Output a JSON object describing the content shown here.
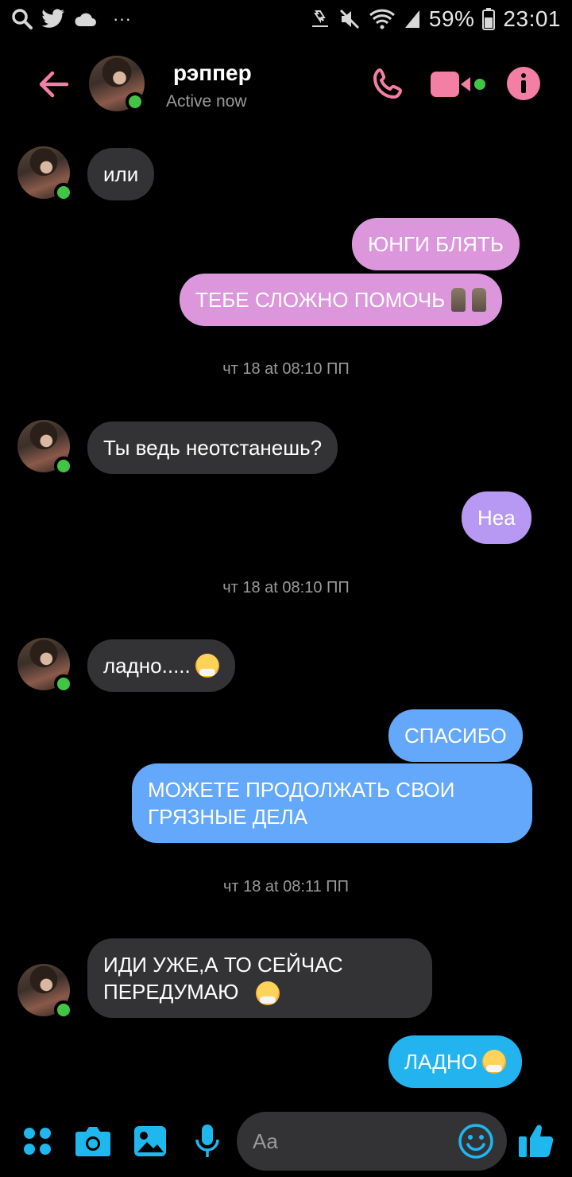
{
  "status_bar": {
    "battery": "59%",
    "time": "23:01",
    "more": "···"
  },
  "header": {
    "contact_name": "рэппер",
    "contact_status": "Active now"
  },
  "messages": [
    {
      "direction": "in",
      "text": "или"
    },
    {
      "direction": "out",
      "text": "ЮНГИ БЛЯТЬ"
    },
    {
      "direction": "out",
      "text": "ТЕБЕ СЛОЖНО ПОМОЧЬ"
    },
    {
      "direction": "in",
      "text": "Ты ведь неотстанешь?"
    },
    {
      "direction": "out",
      "text": "Неа"
    },
    {
      "direction": "in",
      "text": "ладно....."
    },
    {
      "direction": "out",
      "text": "СПАСИБО"
    },
    {
      "direction": "out",
      "text": "МОЖЕТЕ ПРОДОЛЖАТЬ СВОИ ГРЯЗНЫЕ ДЕЛА"
    },
    {
      "direction": "in",
      "text": "ИДИ УЖЕ,А ТО СЕЙЧАС ПЕРЕДУМАЮ"
    },
    {
      "direction": "out",
      "text": "ЛАДНО"
    }
  ],
  "timestamps": [
    "чт 18 at 08:10 ПП",
    "чт 18 at 08:10 ПП",
    "чт 18 at 08:11 ПП"
  ],
  "composer": {
    "placeholder": "Aa"
  },
  "colors": {
    "accent_pink": "#f47fa5",
    "bubble_in": "#333335",
    "bubble_pink": "#dc97dc",
    "bubble_violet": "#b799f3",
    "bubble_blue": "#63a8fb",
    "bubble_cyan": "#23b3ee",
    "toolbar_blue": "#1eb8ef",
    "online_green": "#42c545"
  }
}
